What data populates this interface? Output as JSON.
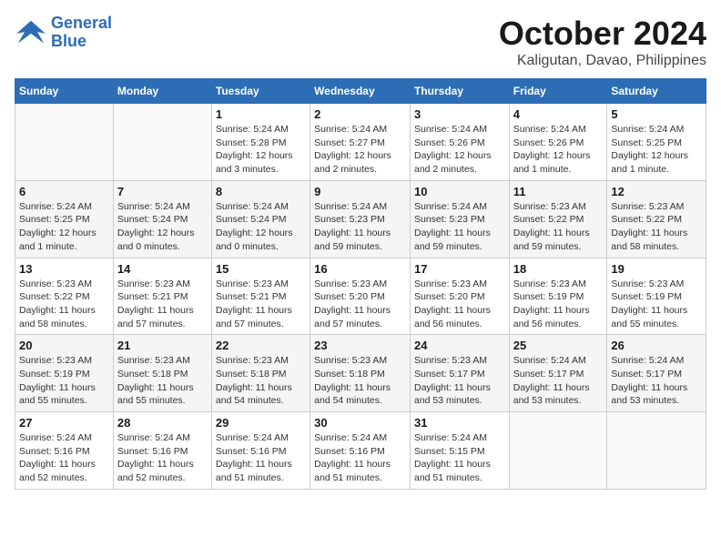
{
  "header": {
    "logo_line1": "General",
    "logo_line2": "Blue",
    "month": "October 2024",
    "location": "Kaligutan, Davao, Philippines"
  },
  "weekdays": [
    "Sunday",
    "Monday",
    "Tuesday",
    "Wednesday",
    "Thursday",
    "Friday",
    "Saturday"
  ],
  "weeks": [
    [
      {
        "day": "",
        "info": ""
      },
      {
        "day": "",
        "info": ""
      },
      {
        "day": "1",
        "info": "Sunrise: 5:24 AM\nSunset: 5:28 PM\nDaylight: 12 hours\nand 3 minutes."
      },
      {
        "day": "2",
        "info": "Sunrise: 5:24 AM\nSunset: 5:27 PM\nDaylight: 12 hours\nand 2 minutes."
      },
      {
        "day": "3",
        "info": "Sunrise: 5:24 AM\nSunset: 5:26 PM\nDaylight: 12 hours\nand 2 minutes."
      },
      {
        "day": "4",
        "info": "Sunrise: 5:24 AM\nSunset: 5:26 PM\nDaylight: 12 hours\nand 1 minute."
      },
      {
        "day": "5",
        "info": "Sunrise: 5:24 AM\nSunset: 5:25 PM\nDaylight: 12 hours\nand 1 minute."
      }
    ],
    [
      {
        "day": "6",
        "info": "Sunrise: 5:24 AM\nSunset: 5:25 PM\nDaylight: 12 hours\nand 1 minute."
      },
      {
        "day": "7",
        "info": "Sunrise: 5:24 AM\nSunset: 5:24 PM\nDaylight: 12 hours\nand 0 minutes."
      },
      {
        "day": "8",
        "info": "Sunrise: 5:24 AM\nSunset: 5:24 PM\nDaylight: 12 hours\nand 0 minutes."
      },
      {
        "day": "9",
        "info": "Sunrise: 5:24 AM\nSunset: 5:23 PM\nDaylight: 11 hours\nand 59 minutes."
      },
      {
        "day": "10",
        "info": "Sunrise: 5:24 AM\nSunset: 5:23 PM\nDaylight: 11 hours\nand 59 minutes."
      },
      {
        "day": "11",
        "info": "Sunrise: 5:23 AM\nSunset: 5:22 PM\nDaylight: 11 hours\nand 59 minutes."
      },
      {
        "day": "12",
        "info": "Sunrise: 5:23 AM\nSunset: 5:22 PM\nDaylight: 11 hours\nand 58 minutes."
      }
    ],
    [
      {
        "day": "13",
        "info": "Sunrise: 5:23 AM\nSunset: 5:22 PM\nDaylight: 11 hours\nand 58 minutes."
      },
      {
        "day": "14",
        "info": "Sunrise: 5:23 AM\nSunset: 5:21 PM\nDaylight: 11 hours\nand 57 minutes."
      },
      {
        "day": "15",
        "info": "Sunrise: 5:23 AM\nSunset: 5:21 PM\nDaylight: 11 hours\nand 57 minutes."
      },
      {
        "day": "16",
        "info": "Sunrise: 5:23 AM\nSunset: 5:20 PM\nDaylight: 11 hours\nand 57 minutes."
      },
      {
        "day": "17",
        "info": "Sunrise: 5:23 AM\nSunset: 5:20 PM\nDaylight: 11 hours\nand 56 minutes."
      },
      {
        "day": "18",
        "info": "Sunrise: 5:23 AM\nSunset: 5:19 PM\nDaylight: 11 hours\nand 56 minutes."
      },
      {
        "day": "19",
        "info": "Sunrise: 5:23 AM\nSunset: 5:19 PM\nDaylight: 11 hours\nand 55 minutes."
      }
    ],
    [
      {
        "day": "20",
        "info": "Sunrise: 5:23 AM\nSunset: 5:19 PM\nDaylight: 11 hours\nand 55 minutes."
      },
      {
        "day": "21",
        "info": "Sunrise: 5:23 AM\nSunset: 5:18 PM\nDaylight: 11 hours\nand 55 minutes."
      },
      {
        "day": "22",
        "info": "Sunrise: 5:23 AM\nSunset: 5:18 PM\nDaylight: 11 hours\nand 54 minutes."
      },
      {
        "day": "23",
        "info": "Sunrise: 5:23 AM\nSunset: 5:18 PM\nDaylight: 11 hours\nand 54 minutes."
      },
      {
        "day": "24",
        "info": "Sunrise: 5:23 AM\nSunset: 5:17 PM\nDaylight: 11 hours\nand 53 minutes."
      },
      {
        "day": "25",
        "info": "Sunrise: 5:24 AM\nSunset: 5:17 PM\nDaylight: 11 hours\nand 53 minutes."
      },
      {
        "day": "26",
        "info": "Sunrise: 5:24 AM\nSunset: 5:17 PM\nDaylight: 11 hours\nand 53 minutes."
      }
    ],
    [
      {
        "day": "27",
        "info": "Sunrise: 5:24 AM\nSunset: 5:16 PM\nDaylight: 11 hours\nand 52 minutes."
      },
      {
        "day": "28",
        "info": "Sunrise: 5:24 AM\nSunset: 5:16 PM\nDaylight: 11 hours\nand 52 minutes."
      },
      {
        "day": "29",
        "info": "Sunrise: 5:24 AM\nSunset: 5:16 PM\nDaylight: 11 hours\nand 51 minutes."
      },
      {
        "day": "30",
        "info": "Sunrise: 5:24 AM\nSunset: 5:16 PM\nDaylight: 11 hours\nand 51 minutes."
      },
      {
        "day": "31",
        "info": "Sunrise: 5:24 AM\nSunset: 5:15 PM\nDaylight: 11 hours\nand 51 minutes."
      },
      {
        "day": "",
        "info": ""
      },
      {
        "day": "",
        "info": ""
      }
    ]
  ]
}
